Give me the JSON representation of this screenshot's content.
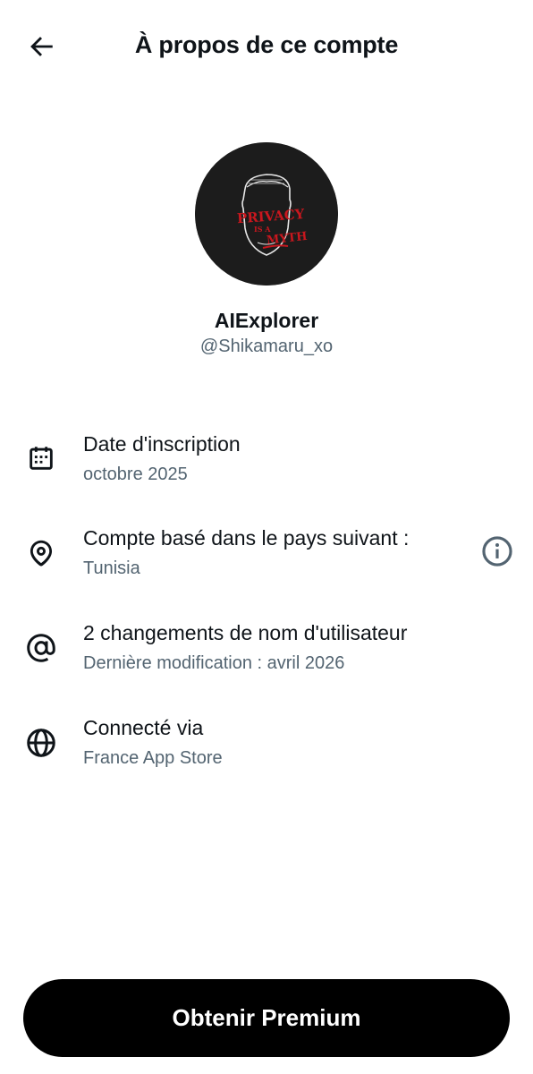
{
  "header": {
    "title": "À propos de ce compte",
    "back_icon": "arrow-left-icon"
  },
  "profile": {
    "display_name": "AIExplorer",
    "handle": "@Shikamaru_xo",
    "avatar_text_line1": "PRIVACY",
    "avatar_text_line2": "IS A",
    "avatar_text_line3": "MYTH"
  },
  "rows": [
    {
      "icon": "calendar-icon",
      "title": "Date d'inscription",
      "subtitle": "octobre 2025"
    },
    {
      "icon": "location-pin-icon",
      "title": "Compte basé dans le pays suivant :",
      "subtitle": "Tunisia",
      "action_icon": "info-icon"
    },
    {
      "icon": "at-sign-icon",
      "title": "2 changements de nom d'utilisateur",
      "subtitle": "Dernière modification : avril 2026"
    },
    {
      "icon": "globe-icon",
      "title": "Connecté via",
      "subtitle": "France App Store"
    }
  ],
  "cta": {
    "label": "Obtenir Premium"
  },
  "colors": {
    "text_primary": "#0f1419",
    "text_secondary": "#536471",
    "button_bg": "#000000",
    "avatar_accent": "#c8171e"
  }
}
